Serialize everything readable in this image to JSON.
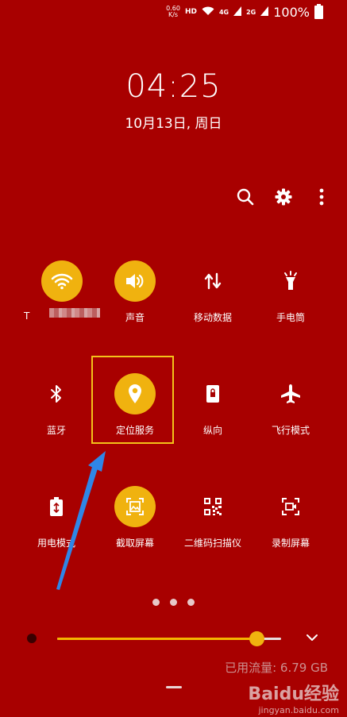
{
  "status_bar": {
    "speed": "0.60\nK/s",
    "hd": "HD",
    "net1": "4G",
    "net2": "2G",
    "battery": "100%"
  },
  "lock": {
    "time": "04:25",
    "date": "10月13日, 周日"
  },
  "header_icons": [
    "search-icon",
    "gear-icon",
    "more-vert-icon"
  ],
  "tiles": [
    {
      "label": "T",
      "icon": "wifi-icon",
      "active": true
    },
    {
      "label": "声音",
      "icon": "volume-icon",
      "active": true
    },
    {
      "label": "移动数据",
      "icon": "arrows-updown-icon",
      "active": false
    },
    {
      "label": "手电筒",
      "icon": "flashlight-icon",
      "active": false
    },
    {
      "label": "蓝牙",
      "icon": "bluetooth-icon",
      "active": false
    },
    {
      "label": "定位服务",
      "icon": "location-pin-icon",
      "active": true
    },
    {
      "label": "纵向",
      "icon": "portrait-lock-icon",
      "active": false
    },
    {
      "label": "飞行模式",
      "icon": "airplane-icon",
      "active": false
    },
    {
      "label": "用电模式",
      "icon": "battery-saver-icon",
      "active": false
    },
    {
      "label": "截取屏幕",
      "icon": "screenshot-icon",
      "active": true
    },
    {
      "label": "二维码扫描仪",
      "icon": "qr-code-icon",
      "active": false
    },
    {
      "label": "录制屏幕",
      "icon": "screen-record-icon",
      "active": false
    }
  ],
  "brightness": {
    "level": 0.89
  },
  "data_usage": "已用流量: 6.79 GB",
  "watermark": {
    "logo": "Baidu经验",
    "url": "jingyan.baidu.com"
  },
  "colors": {
    "background": "#a80000",
    "accent": "#f0b20f",
    "highlight": "#f3c21a",
    "arrow": "#2f86e6"
  }
}
